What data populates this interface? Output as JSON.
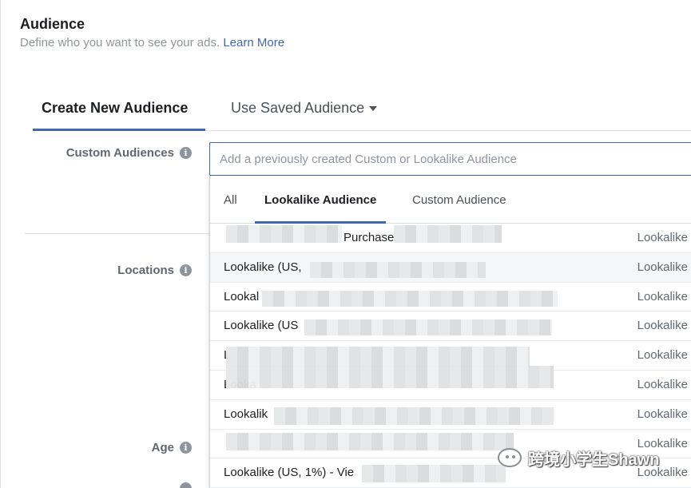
{
  "section": {
    "title": "Audience",
    "description": "Define who you want to see your ads.",
    "learn_more": "Learn More"
  },
  "tabs": {
    "create": "Create New Audience",
    "saved": "Use Saved Audience"
  },
  "labels": {
    "custom_audiences": "Custom Audiences",
    "locations": "Locations",
    "age": "Age",
    "info": "i"
  },
  "search": {
    "placeholder": "Add a previously created Custom or Lookalike Audience"
  },
  "dropdown": {
    "tabs": [
      "All",
      "Lookalike Audience",
      "Custom Audience"
    ],
    "rows": [
      {
        "name": "Purchase",
        "type": "Lookalike"
      },
      {
        "name": "Lookalike (US,",
        "type": "Lookalike"
      },
      {
        "name": "Lookal",
        "type": "Lookalike"
      },
      {
        "name": "Lookalike (US",
        "type": "Lookalike"
      },
      {
        "name": "L",
        "type": "Lookalike"
      },
      {
        "name": "Looka",
        "type": "Lookalike"
      },
      {
        "name": "Lookalik",
        "type": "Lookalike"
      },
      {
        "name": "",
        "type": "Lookalike"
      },
      {
        "name": "Lookalike (US, 1%) - Vie",
        "type": "Lookalike"
      }
    ]
  },
  "watermark": "跨境小学生Shawn",
  "colors": {
    "accent": "#4267b2",
    "muted": "#90949c"
  }
}
